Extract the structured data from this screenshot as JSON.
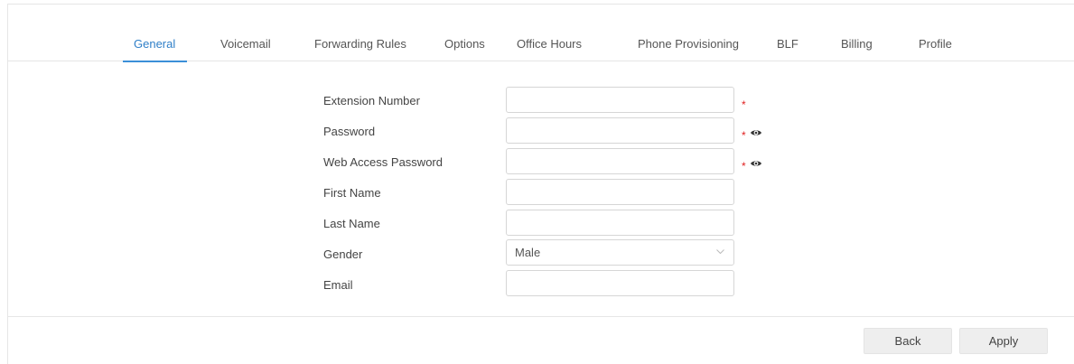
{
  "tabs": [
    {
      "label": "General",
      "active": true
    },
    {
      "label": "Voicemail"
    },
    {
      "label": "Forwarding Rules"
    },
    {
      "label": "Options"
    },
    {
      "label": "Office Hours"
    },
    {
      "label": "Phone Provisioning"
    },
    {
      "label": "BLF"
    },
    {
      "label": "Billing"
    },
    {
      "label": "Profile"
    }
  ],
  "form": {
    "extension_number": {
      "label": "Extension Number",
      "value": "",
      "required": true
    },
    "password": {
      "label": "Password",
      "value": "",
      "required": true,
      "icon": "eye-icon"
    },
    "web_access_password": {
      "label": "Web Access Password",
      "value": "",
      "required": true,
      "icon": "eye-icon"
    },
    "first_name": {
      "label": "First Name",
      "value": ""
    },
    "last_name": {
      "label": "Last Name",
      "value": ""
    },
    "gender": {
      "label": "Gender",
      "value": "Male",
      "icon": "chevron-down-icon"
    },
    "email": {
      "label": "Email",
      "value": ""
    }
  },
  "required_mark": "*",
  "buttons": {
    "back": "Back",
    "apply": "Apply"
  },
  "colors": {
    "accent": "#2f7fc8",
    "required": "#e02020",
    "button_bg": "#eeeeee"
  }
}
